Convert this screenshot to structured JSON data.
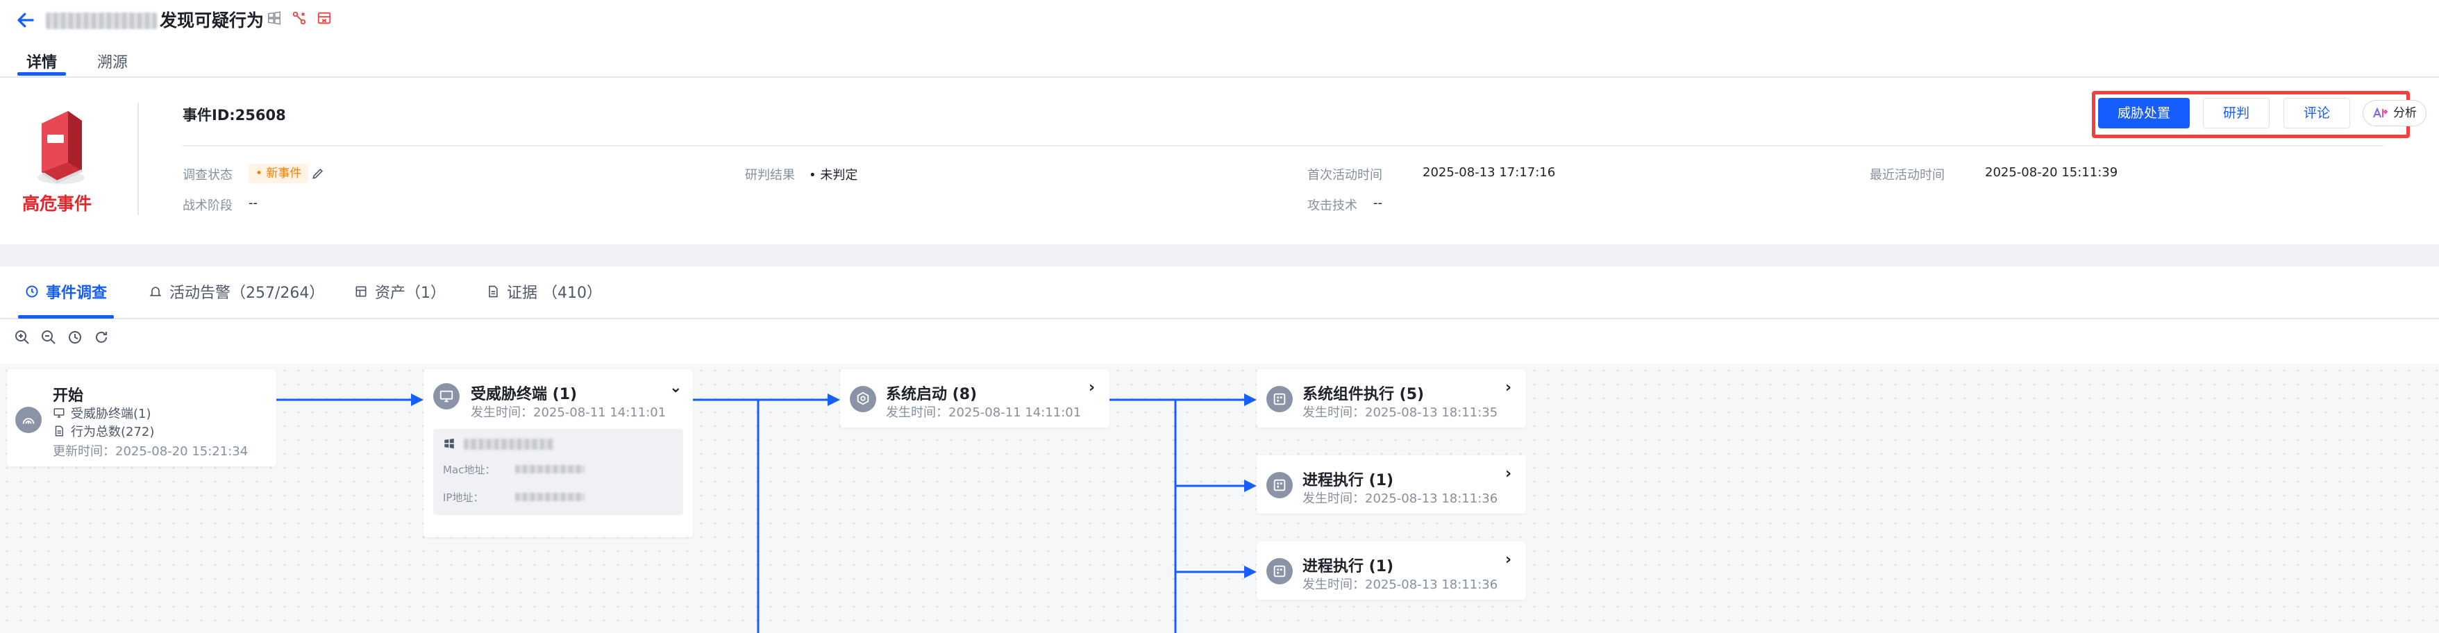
{
  "header": {
    "title_suffix": "发现可疑行为",
    "tabs": [
      "详情",
      "溯源"
    ]
  },
  "summary": {
    "risk_label": "高危事件",
    "event_id": "事件ID:25608",
    "fields": {
      "status_label": "调查状态",
      "status_value": "• 新事件",
      "result_label": "研判结果",
      "result_value": "• 未判定",
      "first_label": "首次活动时间",
      "first_value": "2025-08-13 17:17:16",
      "last_label": "最近活动时间",
      "last_value": "2025-08-20 15:11:39",
      "tactic_label": "战术阶段",
      "tactic_value": "--",
      "technique_label": "攻击技术",
      "technique_value": "--"
    },
    "actions": {
      "dispose": "威胁处置",
      "judge": "研判",
      "comment": "评论",
      "analyze": "分析"
    }
  },
  "lower_tabs": {
    "investigation": "事件调查",
    "alerts": "活动告警（257/264）",
    "assets": "资产（1）",
    "evidence": "证据 （410）"
  },
  "graph": {
    "start": {
      "title": "开始",
      "line1": "受威胁终端(1)",
      "line2": "行为总数(272)",
      "updated": "更新时间：2025-08-20 15:21:34"
    },
    "endpoint": {
      "title": "受威胁终端 (1)",
      "time": "发生时间：2025-08-11 14:11:01",
      "mac_label": "Mac地址：",
      "ip_label": "IP地址："
    },
    "boot": {
      "title": "系统启动 (8)",
      "time": "发生时间：2025-08-11 14:11:01"
    },
    "component": {
      "title": "系统组件执行 (5)",
      "time": "发生时间：2025-08-13 18:11:35"
    },
    "process1": {
      "title": "进程执行 (1)",
      "time": "发生时间：2025-08-13 18:11:36"
    },
    "process2": {
      "title": "进程执行 (1)",
      "time": "发生时间：2025-08-13 18:11:36"
    }
  },
  "colors": {
    "primary": "#165dff",
    "danger": "#e5252a",
    "warning": "#ff7d00"
  }
}
